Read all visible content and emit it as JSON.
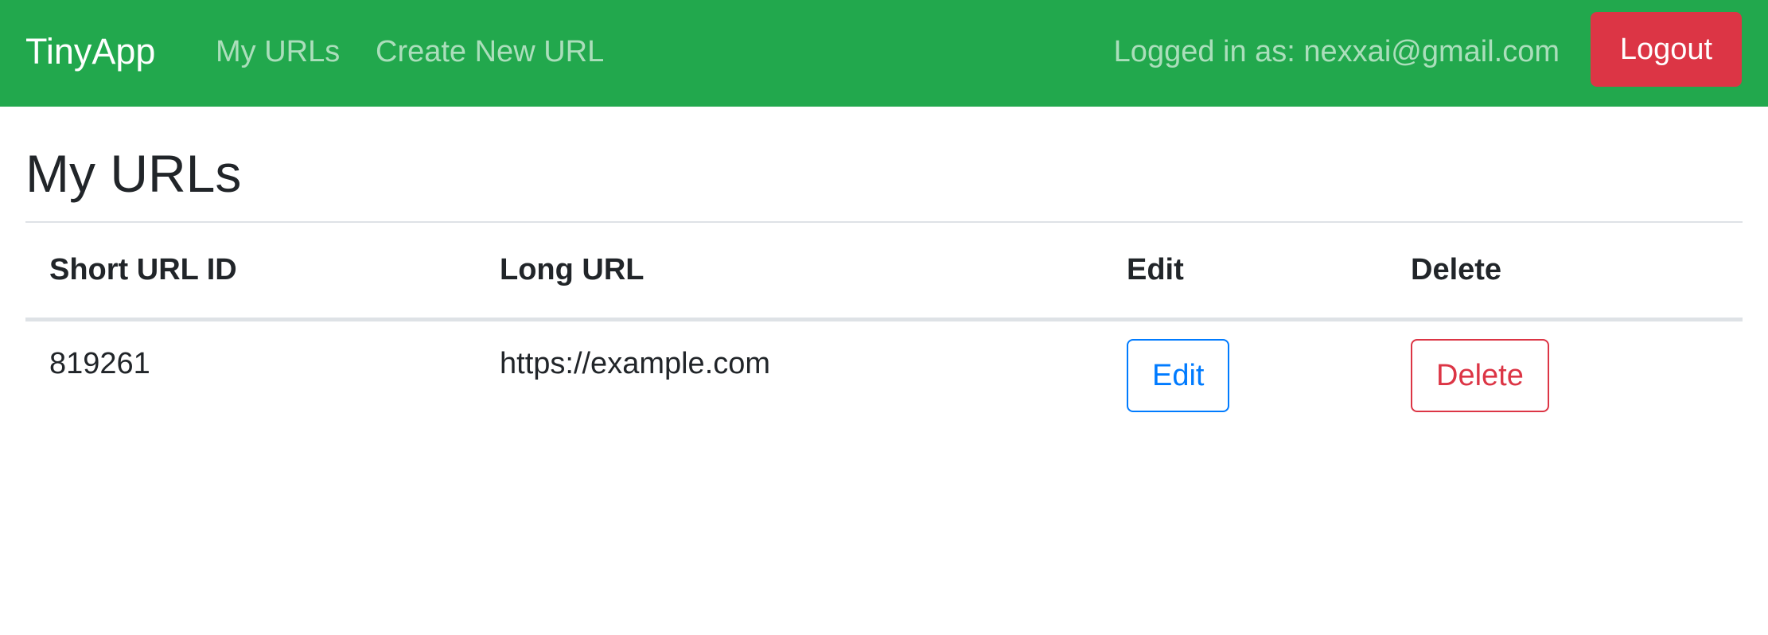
{
  "navbar": {
    "brand": "TinyApp",
    "links": [
      "My URLs",
      "Create New URL"
    ],
    "logged_in_text": "Logged in as: nexxai@gmail.com",
    "logout_label": "Logout",
    "background_color": "#22a84d",
    "logout_color": "#dc3545"
  },
  "page": {
    "title": "My URLs"
  },
  "table": {
    "headers": [
      "Short URL ID",
      "Long URL",
      "Edit",
      "Delete"
    ],
    "rows": [
      {
        "short_id": "819261",
        "long_url": "https://example.com",
        "edit_label": "Edit",
        "delete_label": "Delete"
      }
    ]
  },
  "colors": {
    "edit_button": "#007bff",
    "delete_button": "#dc3545"
  }
}
